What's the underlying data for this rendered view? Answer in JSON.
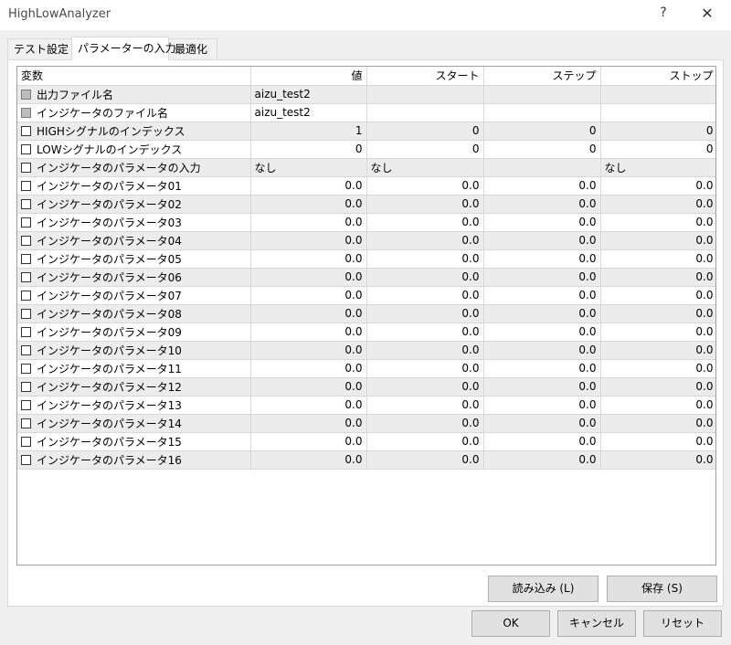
{
  "window": {
    "title": "HighLowAnalyzer",
    "help": "?",
    "close": "✕"
  },
  "tabs": [
    {
      "label": "テスト設定"
    },
    {
      "label": "パラメーターの入力"
    },
    {
      "label": "最適化"
    }
  ],
  "table": {
    "columns": [
      "変数",
      "値",
      "スタート",
      "ステップ",
      "ストップ"
    ],
    "rows": [
      {
        "name": "出力ファイル名",
        "value": "aizu_test2",
        "start": "",
        "step": "",
        "stop": "",
        "disabled": true,
        "textual": true
      },
      {
        "name": "インジケータのファイル名",
        "value": "aizu_test2",
        "start": "",
        "step": "",
        "stop": "",
        "disabled": true,
        "textual": true
      },
      {
        "name": "HIGHシグナルのインデックス",
        "value": "1",
        "start": "0",
        "step": "0",
        "stop": "0"
      },
      {
        "name": "LOWシグナルのインデックス",
        "value": "0",
        "start": "0",
        "step": "0",
        "stop": "0"
      },
      {
        "name": "インジケータのパラメータの入力",
        "value": "なし",
        "start": "なし",
        "step": "",
        "stop": "なし",
        "textual": true
      },
      {
        "name": "インジケータのパラメータ01",
        "value": "0.0",
        "start": "0.0",
        "step": "0.0",
        "stop": "0.0"
      },
      {
        "name": "インジケータのパラメータ02",
        "value": "0.0",
        "start": "0.0",
        "step": "0.0",
        "stop": "0.0"
      },
      {
        "name": "インジケータのパラメータ03",
        "value": "0.0",
        "start": "0.0",
        "step": "0.0",
        "stop": "0.0"
      },
      {
        "name": "インジケータのパラメータ04",
        "value": "0.0",
        "start": "0.0",
        "step": "0.0",
        "stop": "0.0"
      },
      {
        "name": "インジケータのパラメータ05",
        "value": "0.0",
        "start": "0.0",
        "step": "0.0",
        "stop": "0.0"
      },
      {
        "name": "インジケータのパラメータ06",
        "value": "0.0",
        "start": "0.0",
        "step": "0.0",
        "stop": "0.0"
      },
      {
        "name": "インジケータのパラメータ07",
        "value": "0.0",
        "start": "0.0",
        "step": "0.0",
        "stop": "0.0"
      },
      {
        "name": "インジケータのパラメータ08",
        "value": "0.0",
        "start": "0.0",
        "step": "0.0",
        "stop": "0.0"
      },
      {
        "name": "インジケータのパラメータ09",
        "value": "0.0",
        "start": "0.0",
        "step": "0.0",
        "stop": "0.0"
      },
      {
        "name": "インジケータのパラメータ10",
        "value": "0.0",
        "start": "0.0",
        "step": "0.0",
        "stop": "0.0"
      },
      {
        "name": "インジケータのパラメータ11",
        "value": "0.0",
        "start": "0.0",
        "step": "0.0",
        "stop": "0.0"
      },
      {
        "name": "インジケータのパラメータ12",
        "value": "0.0",
        "start": "0.0",
        "step": "0.0",
        "stop": "0.0"
      },
      {
        "name": "インジケータのパラメータ13",
        "value": "0.0",
        "start": "0.0",
        "step": "0.0",
        "stop": "0.0"
      },
      {
        "name": "インジケータのパラメータ14",
        "value": "0.0",
        "start": "0.0",
        "step": "0.0",
        "stop": "0.0"
      },
      {
        "name": "インジケータのパラメータ15",
        "value": "0.0",
        "start": "0.0",
        "step": "0.0",
        "stop": "0.0"
      },
      {
        "name": "インジケータのパラメータ16",
        "value": "0.0",
        "start": "0.0",
        "step": "0.0",
        "stop": "0.0"
      }
    ]
  },
  "buttons": {
    "load": "読み込み (L)",
    "save": "保存 (S)",
    "ok": "OK",
    "cancel": "キャンセル",
    "reset": "リセット"
  }
}
